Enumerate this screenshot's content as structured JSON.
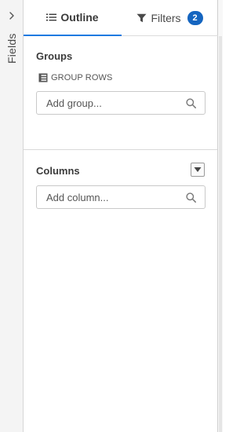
{
  "fields_rail": {
    "label": "Fields",
    "chevron_icon": "chevron-right-icon"
  },
  "tabs": [
    {
      "label": "Outline",
      "icon": "list-icon",
      "active": true
    },
    {
      "label": "Filters",
      "icon": "filter-funnel-icon",
      "badge": "2"
    }
  ],
  "groups": {
    "title": "Groups",
    "group_rows_label": "GROUP ROWS",
    "group_rows_icon": "table-rows-icon",
    "input": {
      "value": "",
      "placeholder": "Add group..."
    }
  },
  "columns": {
    "title": "Columns",
    "toggle_icon": "caret-down-icon",
    "input": {
      "value": "",
      "placeholder": "Add column..."
    }
  },
  "colors": {
    "accent": "#1f7ae0",
    "badge": "#1565c0",
    "rail_background": "#f4f4f4",
    "border": "#c9c9c9"
  }
}
